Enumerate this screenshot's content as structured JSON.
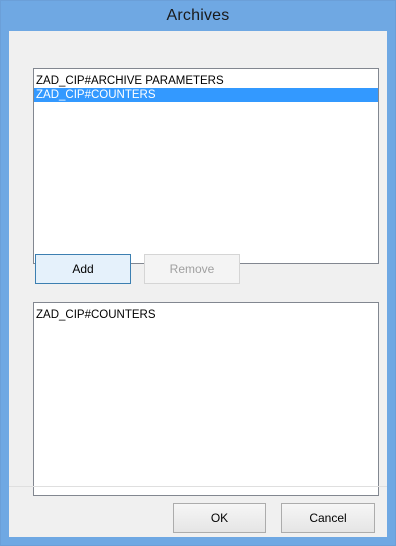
{
  "window": {
    "title": "Archives"
  },
  "archives_list": {
    "items": [
      {
        "label": "ZAD_CIP#ARCHIVE PARAMETERS",
        "selected": false
      },
      {
        "label": "ZAD_CIP#COUNTERS",
        "selected": true
      }
    ]
  },
  "buttons": {
    "add_label": "Add",
    "remove_label": "Remove",
    "ok_label": "OK",
    "cancel_label": "Cancel"
  },
  "selected_list": {
    "items": [
      {
        "label": "ZAD_CIP#COUNTERS"
      }
    ]
  },
  "colors": {
    "titlebar": "#6fa8e3",
    "selection": "#3399ff",
    "dialog_background": "#f0f0f0"
  }
}
